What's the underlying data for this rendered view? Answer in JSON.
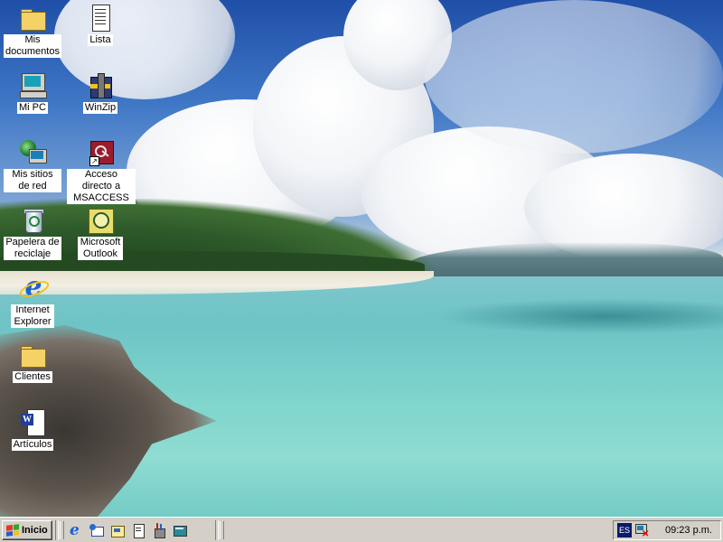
{
  "desktop": {
    "icons": [
      {
        "label": "Mis documentos",
        "icon": "my-documents-folder-icon"
      },
      {
        "label": "Lista",
        "icon": "text-document-icon"
      },
      {
        "label": "Mi PC",
        "icon": "my-computer-icon"
      },
      {
        "label": "WinZip",
        "icon": "winzip-icon"
      },
      {
        "label": "Mis sitios de red",
        "icon": "network-places-icon"
      },
      {
        "label": "Acceso directo a MSACCESS",
        "icon": "msaccess-shortcut-icon"
      },
      {
        "label": "Papelera de reciclaje",
        "icon": "recycle-bin-icon"
      },
      {
        "label": "Microsoft Outlook",
        "icon": "outlook-icon"
      },
      {
        "label": "Internet Explorer",
        "icon": "internet-explorer-icon"
      },
      {
        "label": "Clientes",
        "icon": "folder-icon"
      },
      {
        "label": "Artículos",
        "icon": "word-document-icon"
      }
    ]
  },
  "taskbar": {
    "start_label": "Inicio",
    "quick_launch": [
      "internet-explorer-icon",
      "outlook-express-icon",
      "show-desktop-icon",
      "notepad-icon",
      "tools-icon",
      "channels-icon"
    ],
    "tray": {
      "language": "ES",
      "network_icon": "network-disconnected-icon",
      "clock": "09:23 p.m."
    }
  },
  "colors": {
    "taskbar_bg": "#d4d0c8",
    "label_bg": "#ffffff"
  }
}
